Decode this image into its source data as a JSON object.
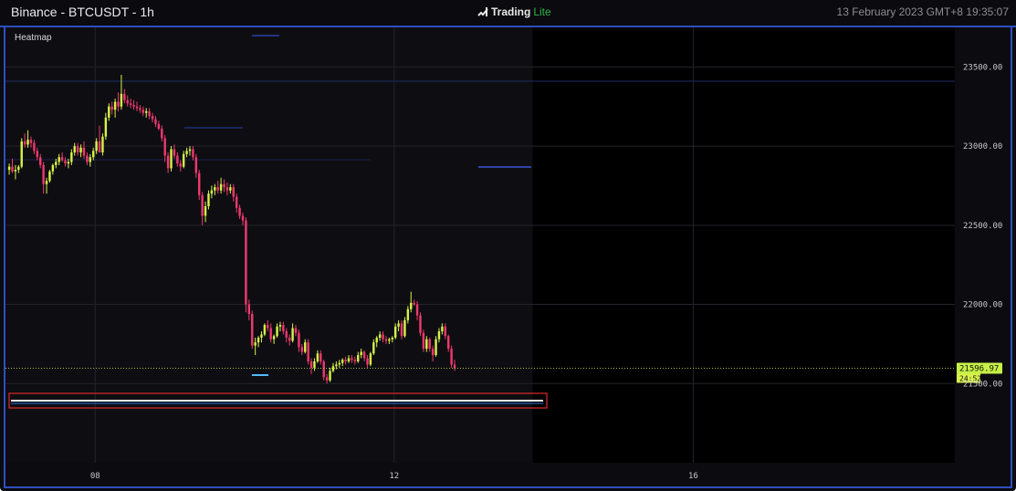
{
  "window": {
    "title": "Binance - BTCUSDT - 1h",
    "brand_name": "Trading",
    "brand_suffix": "Lite",
    "timestamp": "13 February 2023 GMT+8 19:35:07"
  },
  "colors": {
    "up": "#d6f24a",
    "down": "#f0386e",
    "accent_border": "#2d4fbf",
    "price_tag_bg": "#c7f046",
    "selection_box": "#e02828",
    "heat_line": "#3a57d6"
  },
  "chart_data": {
    "type": "candlestick",
    "title": "Heatmap",
    "y_ticks": [
      "23500.00",
      "23000.00",
      "22500.00",
      "22000.00",
      "21500.00"
    ],
    "y_tick_values": [
      23500,
      23000,
      22500,
      22000,
      21500
    ],
    "x_ticks": [
      "08",
      "12",
      "16"
    ],
    "x_tick_days": [
      8,
      12,
      16
    ],
    "x_range_days": [
      6.8,
      19.5
    ],
    "ylim": [
      21000,
      23750
    ],
    "last_price": "21596.97",
    "last_price_value": 21596.97,
    "countdown": "24:52",
    "grid": true,
    "future_region_start_day": 13.85,
    "candle_interval_days": 0.04166667,
    "first_candle_day": 6.85,
    "candles_ohlc": [
      [
        22850,
        22890,
        22820,
        22870
      ],
      [
        22870,
        22920,
        22830,
        22840
      ],
      [
        22840,
        22880,
        22790,
        22850
      ],
      [
        22850,
        22880,
        22830,
        22870
      ],
      [
        22870,
        23050,
        22860,
        23030
      ],
      [
        23030,
        23080,
        22990,
        23010
      ],
      [
        23010,
        23100,
        22990,
        23040
      ],
      [
        23040,
        23060,
        22990,
        23020
      ],
      [
        23020,
        23040,
        22950,
        22970
      ],
      [
        22970,
        22990,
        22910,
        22930
      ],
      [
        22930,
        22950,
        22860,
        22880
      ],
      [
        22880,
        22900,
        22700,
        22760
      ],
      [
        22760,
        22800,
        22700,
        22780
      ],
      [
        22780,
        22850,
        22770,
        22840
      ],
      [
        22840,
        22890,
        22820,
        22880
      ],
      [
        22880,
        22920,
        22860,
        22900
      ],
      [
        22900,
        22950,
        22880,
        22930
      ],
      [
        22930,
        22960,
        22900,
        22910
      ],
      [
        22910,
        22930,
        22870,
        22890
      ],
      [
        22890,
        22920,
        22860,
        22900
      ],
      [
        22900,
        22980,
        22880,
        22960
      ],
      [
        22960,
        23020,
        22940,
        23000
      ],
      [
        23000,
        23020,
        22940,
        22960
      ],
      [
        22960,
        23010,
        22930,
        22990
      ],
      [
        22990,
        23030,
        22920,
        22940
      ],
      [
        22940,
        22960,
        22880,
        22900
      ],
      [
        22900,
        22950,
        22870,
        22930
      ],
      [
        22930,
        22990,
        22910,
        22970
      ],
      [
        22970,
        23050,
        22950,
        23030
      ],
      [
        23030,
        23130,
        22960,
        22960
      ],
      [
        22960,
        23080,
        22940,
        23060
      ],
      [
        23060,
        23210,
        23040,
        23180
      ],
      [
        23180,
        23270,
        23160,
        23250
      ],
      [
        23250,
        23280,
        23200,
        23230
      ],
      [
        23230,
        23300,
        23180,
        23280
      ],
      [
        23280,
        23340,
        23220,
        23250
      ],
      [
        23250,
        23450,
        23230,
        23330
      ],
      [
        23330,
        23360,
        23270,
        23290
      ],
      [
        23290,
        23320,
        23250,
        23270
      ],
      [
        23270,
        23300,
        23240,
        23260
      ],
      [
        23260,
        23290,
        23230,
        23250
      ],
      [
        23250,
        23280,
        23220,
        23240
      ],
      [
        23240,
        23260,
        23210,
        23230
      ],
      [
        23230,
        23250,
        23190,
        23210
      ],
      [
        23210,
        23240,
        23180,
        23220
      ],
      [
        23220,
        23240,
        23170,
        23190
      ],
      [
        23190,
        23210,
        23150,
        23170
      ],
      [
        23170,
        23190,
        23120,
        23140
      ],
      [
        23140,
        23160,
        23100,
        23110
      ],
      [
        23110,
        23130,
        23030,
        23050
      ],
      [
        23050,
        23070,
        22900,
        22940
      ],
      [
        22940,
        22960,
        22830,
        22860
      ],
      [
        22860,
        23000,
        22840,
        22980
      ],
      [
        22980,
        23010,
        22920,
        22940
      ],
      [
        22940,
        22960,
        22870,
        22890
      ],
      [
        22890,
        22910,
        22840,
        22870
      ],
      [
        22870,
        22970,
        22860,
        22950
      ],
      [
        22950,
        22990,
        22930,
        22970
      ],
      [
        22970,
        23000,
        22940,
        22980
      ],
      [
        22980,
        23000,
        22910,
        22930
      ],
      [
        22930,
        22950,
        22800,
        22830
      ],
      [
        22830,
        22850,
        22660,
        22690
      ],
      [
        22690,
        22710,
        22500,
        22560
      ],
      [
        22560,
        22650,
        22520,
        22620
      ],
      [
        22620,
        22720,
        22600,
        22700
      ],
      [
        22700,
        22750,
        22670,
        22720
      ],
      [
        22720,
        22760,
        22690,
        22740
      ],
      [
        22740,
        22780,
        22700,
        22720
      ],
      [
        22720,
        22800,
        22700,
        22760
      ],
      [
        22760,
        22790,
        22710,
        22740
      ],
      [
        22740,
        22770,
        22690,
        22720
      ],
      [
        22720,
        22760,
        22700,
        22740
      ],
      [
        22740,
        22760,
        22650,
        22680
      ],
      [
        22680,
        22700,
        22580,
        22610
      ],
      [
        22610,
        22630,
        22540,
        22560
      ],
      [
        22560,
        22580,
        22500,
        22530
      ],
      [
        22530,
        22550,
        21950,
        22000
      ],
      [
        22000,
        22030,
        21900,
        21940
      ],
      [
        21940,
        21960,
        21720,
        21740
      ],
      [
        21740,
        21790,
        21680,
        21760
      ],
      [
        21760,
        21800,
        21730,
        21790
      ],
      [
        21790,
        21830,
        21760,
        21810
      ],
      [
        21810,
        21880,
        21800,
        21870
      ],
      [
        21870,
        21900,
        21830,
        21850
      ],
      [
        21850,
        21880,
        21760,
        21780
      ],
      [
        21780,
        21810,
        21750,
        21800
      ],
      [
        21800,
        21880,
        21790,
        21860
      ],
      [
        21860,
        21890,
        21830,
        21870
      ],
      [
        21870,
        21890,
        21810,
        21830
      ],
      [
        21830,
        21850,
        21760,
        21790
      ],
      [
        21790,
        21810,
        21740,
        21770
      ],
      [
        21770,
        21880,
        21760,
        21850
      ],
      [
        21850,
        21870,
        21800,
        21820
      ],
      [
        21820,
        21840,
        21700,
        21730
      ],
      [
        21730,
        21750,
        21680,
        21700
      ],
      [
        21700,
        21780,
        21690,
        21760
      ],
      [
        21760,
        21780,
        21620,
        21640
      ],
      [
        21640,
        21660,
        21560,
        21600
      ],
      [
        21600,
        21660,
        21580,
        21640
      ],
      [
        21640,
        21710,
        21630,
        21690
      ],
      [
        21690,
        21710,
        21620,
        21640
      ],
      [
        21640,
        21650,
        21520,
        21540
      ],
      [
        21540,
        21560,
        21500,
        21520
      ],
      [
        21520,
        21600,
        21510,
        21580
      ],
      [
        21580,
        21630,
        21570,
        21610
      ],
      [
        21610,
        21640,
        21590,
        21620
      ],
      [
        21620,
        21650,
        21600,
        21630
      ],
      [
        21630,
        21660,
        21610,
        21650
      ],
      [
        21650,
        21670,
        21620,
        21640
      ],
      [
        21640,
        21680,
        21630,
        21660
      ],
      [
        21660,
        21680,
        21630,
        21650
      ],
      [
        21650,
        21670,
        21620,
        21640
      ],
      [
        21640,
        21700,
        21630,
        21680
      ],
      [
        21680,
        21720,
        21660,
        21700
      ],
      [
        21700,
        21710,
        21640,
        21660
      ],
      [
        21660,
        21680,
        21600,
        21620
      ],
      [
        21620,
        21700,
        21610,
        21690
      ],
      [
        21690,
        21780,
        21680,
        21760
      ],
      [
        21760,
        21800,
        21730,
        21790
      ],
      [
        21790,
        21830,
        21770,
        21810
      ],
      [
        21810,
        21830,
        21760,
        21780
      ],
      [
        21780,
        21800,
        21750,
        21770
      ],
      [
        21770,
        21790,
        21750,
        21780
      ],
      [
        21780,
        21800,
        21760,
        21790
      ],
      [
        21790,
        21880,
        21780,
        21860
      ],
      [
        21860,
        21900,
        21830,
        21880
      ],
      [
        21880,
        21900,
        21780,
        21800
      ],
      [
        21800,
        21920,
        21790,
        21900
      ],
      [
        21900,
        21990,
        21880,
        21970
      ],
      [
        21970,
        22080,
        21950,
        22010
      ],
      [
        22010,
        22030,
        21990,
        22000
      ],
      [
        22000,
        22020,
        21900,
        21930
      ],
      [
        21930,
        21950,
        21800,
        21820
      ],
      [
        21820,
        21840,
        21700,
        21720
      ],
      [
        21720,
        21800,
        21700,
        21780
      ],
      [
        21780,
        21790,
        21700,
        21720
      ],
      [
        21720,
        21740,
        21640,
        21680
      ],
      [
        21680,
        21800,
        21670,
        21780
      ],
      [
        21780,
        21850,
        21760,
        21830
      ],
      [
        21830,
        21880,
        21810,
        21860
      ],
      [
        21860,
        21880,
        21780,
        21800
      ],
      [
        21800,
        21810,
        21700,
        21720
      ],
      [
        21720,
        21740,
        21600,
        21620
      ],
      [
        21620,
        21650,
        21580,
        21597
      ]
    ]
  }
}
